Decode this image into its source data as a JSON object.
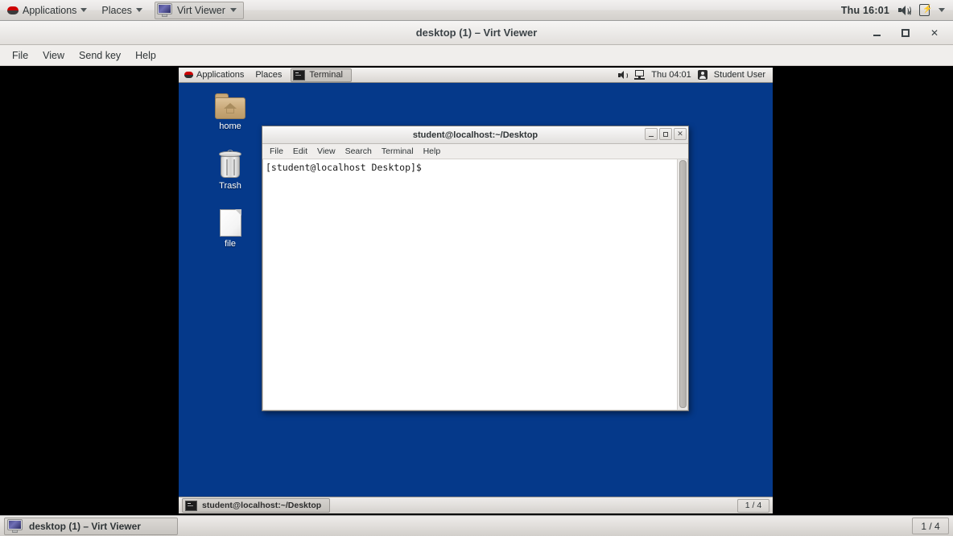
{
  "host_panel": {
    "applications_label": "Applications",
    "places_label": "Places",
    "window_button_label": "Virt Viewer",
    "clock": "Thu 16:01",
    "icons": {
      "menu_icon": "redhat-icon",
      "window_icon": "monitor-icon",
      "volume_icon": "speaker-muted-icon",
      "power_icon": "battery-charging-icon",
      "user_menu_icon": "chevron-down-icon"
    }
  },
  "virt_viewer": {
    "title": "desktop (1) – Virt Viewer",
    "controls": {
      "minimize": "minimize-button",
      "maximize": "maximize-button",
      "close": "close-button"
    },
    "menu": [
      {
        "label": "File"
      },
      {
        "label": "View"
      },
      {
        "label": "Send key"
      },
      {
        "label": "Help"
      }
    ]
  },
  "guest": {
    "top_panel": {
      "applications_label": "Applications",
      "places_label": "Places",
      "window_button_label": "Terminal",
      "clock": "Thu 04:01",
      "user_label": "Student User"
    },
    "desktop_icons": [
      {
        "label": "home",
        "icon": "home-folder-icon"
      },
      {
        "label": "Trash",
        "icon": "trash-can-icon"
      },
      {
        "label": "file",
        "icon": "document-icon"
      }
    ],
    "terminal": {
      "title": "student@localhost:~/Desktop",
      "menu": [
        {
          "label": "File"
        },
        {
          "label": "Edit"
        },
        {
          "label": "View"
        },
        {
          "label": "Search"
        },
        {
          "label": "Terminal"
        },
        {
          "label": "Help"
        }
      ],
      "content": "[student@localhost Desktop]$ "
    },
    "bottom_panel": {
      "task_button_label": "student@localhost:~/Desktop",
      "workspace_indicator": "1 / 4"
    }
  },
  "host_taskbar": {
    "task_button_label": "desktop (1) – Virt Viewer",
    "workspace_indicator": "1 / 4"
  },
  "colors": {
    "desktop_blue": "#05398a",
    "panel_grey": "#e2dfdc",
    "redhat_red": "#cc0000",
    "letterbox_black": "#000000"
  }
}
